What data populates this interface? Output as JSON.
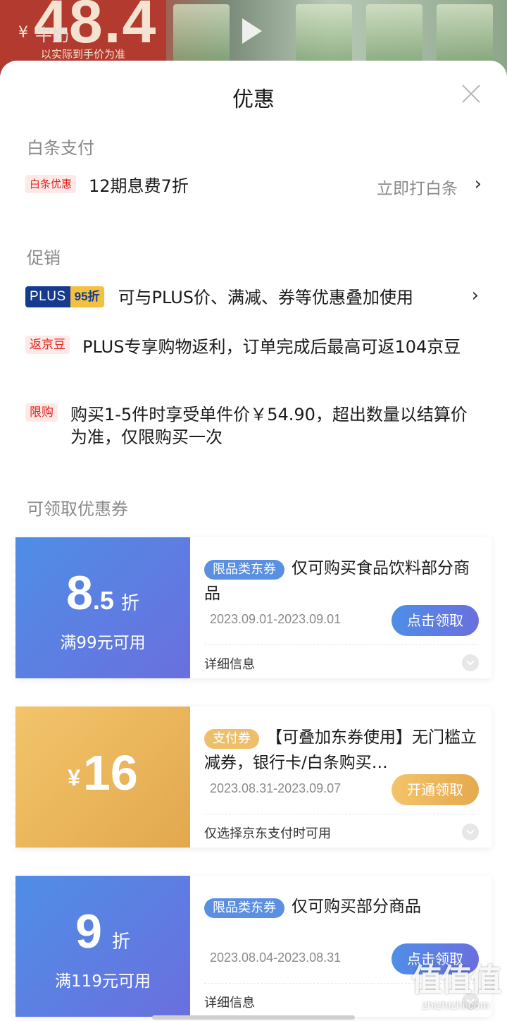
{
  "background": {
    "price": "48.4",
    "currency": "¥",
    "search_text": "牛奶",
    "price_note": "以实际到手价为准"
  },
  "sheet": {
    "title": "优惠"
  },
  "baitiao": {
    "section_title": "白条支付",
    "tag": "白条优惠",
    "text": "12期息费7折",
    "action": "立即打白条",
    "arrow": "›"
  },
  "promo": {
    "section_title": "促销",
    "items": [
      {
        "tag_part1": "PLUS",
        "tag_part2": "95折",
        "text": "可与PLUS价、满减、券等优惠叠加使用",
        "arrow": "›"
      },
      {
        "tag": "返京豆",
        "text": "PLUS专享购物返利，订单完成后最高可返104京豆"
      },
      {
        "tag": "限购",
        "text": "购买1-5件时享受单件价￥54.90，超出数量以结算价为准，仅限购买一次"
      }
    ]
  },
  "coupons": {
    "section_title": "可领取优惠券",
    "items": [
      {
        "value_main": "8",
        "value_dec": ".5",
        "value_unit": "折",
        "condition": "满99元可用",
        "tag": "限品类东券",
        "desc": "仅可购买食品饮料部分商品",
        "date": "2023.09.01-2023.09.01",
        "button": "点击领取",
        "detail": "详细信息"
      },
      {
        "currency": "¥",
        "value_main": "16",
        "tag": "支付券",
        "desc": "【可叠加东券使用】无门槛立减券，银行卡/白条购买…",
        "date": "2023.08.31-2023.09.07",
        "button": "开通领取",
        "detail": "仅选择京东支付时可用"
      },
      {
        "value_main": "9",
        "value_unit": "折",
        "condition": "满119元可用",
        "tag": "限品类东券",
        "desc": "仅可购买部分商品",
        "date": "2023.08.04-2023.08.31",
        "button": "点击领取",
        "detail": "详细信息"
      }
    ]
  },
  "watermark": {
    "logo": "值值值",
    "url": "zhizhizhi.com"
  },
  "colors": {
    "accent_red": "#e2231a",
    "coupon_blue": "#5a8fe2",
    "coupon_gold": "#eebf6a",
    "plus_navy": "#163b8d",
    "plus_yellow": "#f3c13f"
  }
}
